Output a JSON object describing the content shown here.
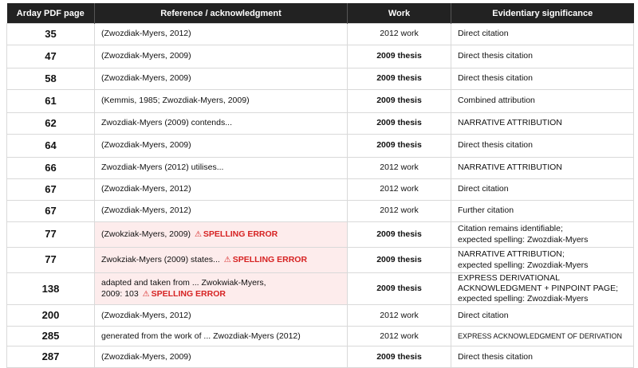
{
  "headers": {
    "page": "Arday PDF page",
    "reference": "Reference / acknowledgment",
    "work": "Work",
    "significance": "Evidentiary significance"
  },
  "spelling_error_label": "SPELLING ERROR",
  "warning_icon": "warning-triangle-icon",
  "error_color": "#d62222",
  "error_row_background": "#fdecec",
  "rows": [
    {
      "page": "35",
      "reference": "(Zwozdiak-Myers, 2012)",
      "work": "2012 work",
      "significance": "Direct citation"
    },
    {
      "page": "47",
      "reference": "(Zwozdiak-Myers, 2009)",
      "work": "2009 thesis",
      "significance": "Direct thesis citation"
    },
    {
      "page": "58",
      "reference": "(Zwozdiak-Myers, 2009)",
      "work": "2009 thesis",
      "significance": "Direct thesis citation"
    },
    {
      "page": "61",
      "reference": "(Kemmis, 1985; Zwozdiak-Myers, 2009)",
      "work": "2009 thesis",
      "significance": "Combined attribution"
    },
    {
      "page": "62",
      "reference": "Zwozdiak-Myers (2009) contends...",
      "work": "2009 thesis",
      "significance": "NARRATIVE ATTRIBUTION"
    },
    {
      "page": "64",
      "reference": "(Zwozdiak-Myers, 2009)",
      "work": "2009 thesis",
      "significance": "Direct thesis citation"
    },
    {
      "page": "66",
      "reference": "Zwozdiak-Myers (2012) utilises...",
      "work": "2012 work",
      "significance": "NARRATIVE ATTRIBUTION"
    },
    {
      "page": "67",
      "reference": "(Zwozdiak-Myers, 2012)",
      "work": "2012 work",
      "significance": "Direct citation"
    },
    {
      "page": "67",
      "reference": "(Zwozdiak-Myers, 2012)",
      "work": "2012 work",
      "significance": "Further citation"
    },
    {
      "page": "77",
      "reference": "(Zwokziak-Myers, 2009)",
      "work": "2009 thesis",
      "significance_lines": [
        "Citation remains identifiable;",
        "expected spelling: Zwozdiak-Myers"
      ]
    },
    {
      "page": "77",
      "reference": "Zwokziak-Myers (2009) states...",
      "work": "2009 thesis",
      "significance_lines": [
        "NARRATIVE ATTRIBUTION;",
        "expected spelling: Zwozdiak-Myers"
      ]
    },
    {
      "page": "138",
      "reference_lines": [
        "adapted and taken from ... Zwokwiak-Myers,",
        "2009: 103"
      ],
      "work": "2009 thesis",
      "significance_lines": [
        "EXPRESS DERIVATIONAL",
        "ACKNOWLEDGMENT + PINPOINT PAGE;",
        "expected spelling: Zwozdiak-Myers"
      ]
    },
    {
      "page": "200",
      "reference": "(Zwozdiak-Myers, 2012)",
      "work": "2012 work",
      "significance": "Direct citation"
    },
    {
      "page": "285",
      "reference": "generated from the work of ... Zwozdiak-Myers (2012)",
      "work": "2012 work",
      "significance": "EXPRESS ACKNOWLEDGMENT OF DERIVATION"
    },
    {
      "page": "287",
      "reference": "(Zwozdiak-Myers, 2009)",
      "work": "2009 thesis",
      "significance": "Direct thesis citation"
    }
  ]
}
